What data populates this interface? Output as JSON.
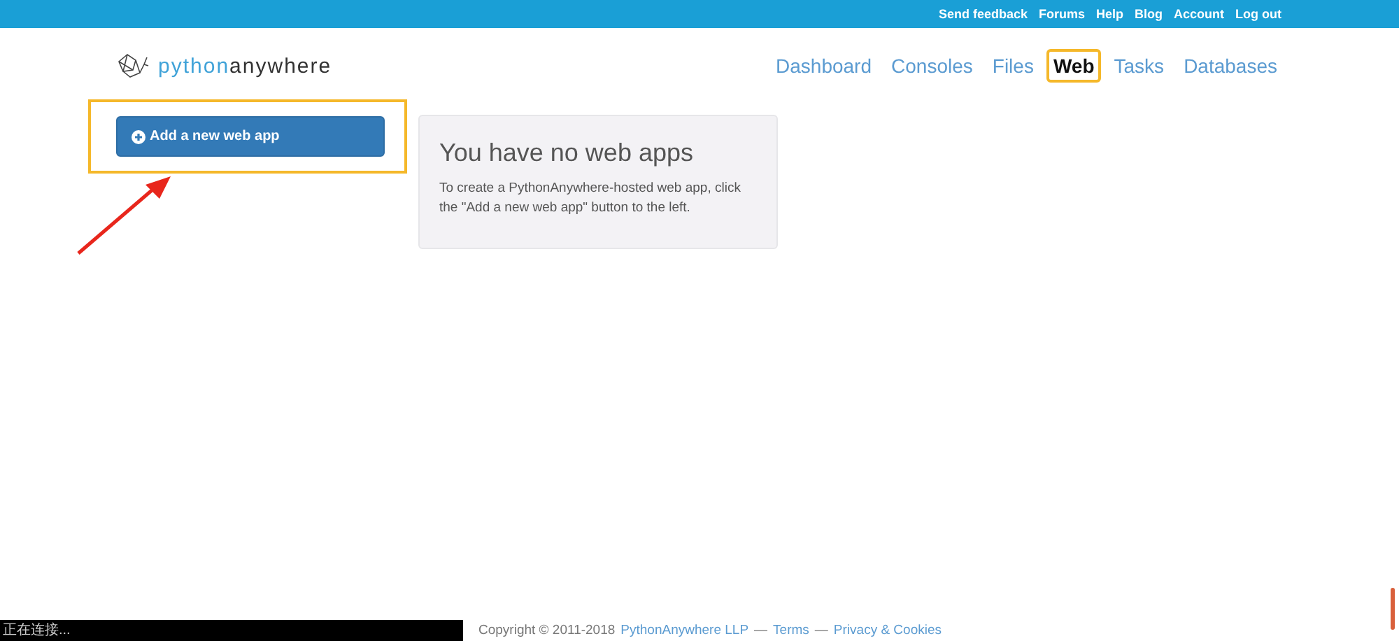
{
  "top_links": [
    "Send feedback",
    "Forums",
    "Help",
    "Blog",
    "Account",
    "Log out"
  ],
  "logo": [
    "python",
    "anywhere"
  ],
  "nav": [
    {
      "label": "Dashboard",
      "selected": false
    },
    {
      "label": "Consoles",
      "selected": false
    },
    {
      "label": "Files",
      "selected": false
    },
    {
      "label": "Web",
      "selected": true
    },
    {
      "label": "Tasks",
      "selected": false
    },
    {
      "label": "Databases",
      "selected": false
    }
  ],
  "add_button": "Add a new web app",
  "panel": {
    "title": "You have no web apps",
    "text": "To create a PythonAnywhere-hosted web app, click the \"Add a new web app\" button to the left."
  },
  "status": "正在连接...",
  "footer": {
    "copyright": "Copyright © 2011-2018",
    "items": [
      {
        "kind": "link",
        "text": "PythonAnywhere LLP"
      },
      {
        "kind": "sep",
        "text": "—"
      },
      {
        "kind": "link",
        "text": "Terms"
      },
      {
        "kind": "sep",
        "text": "—"
      },
      {
        "kind": "link",
        "text": "Privacy & Cookies"
      }
    ]
  }
}
